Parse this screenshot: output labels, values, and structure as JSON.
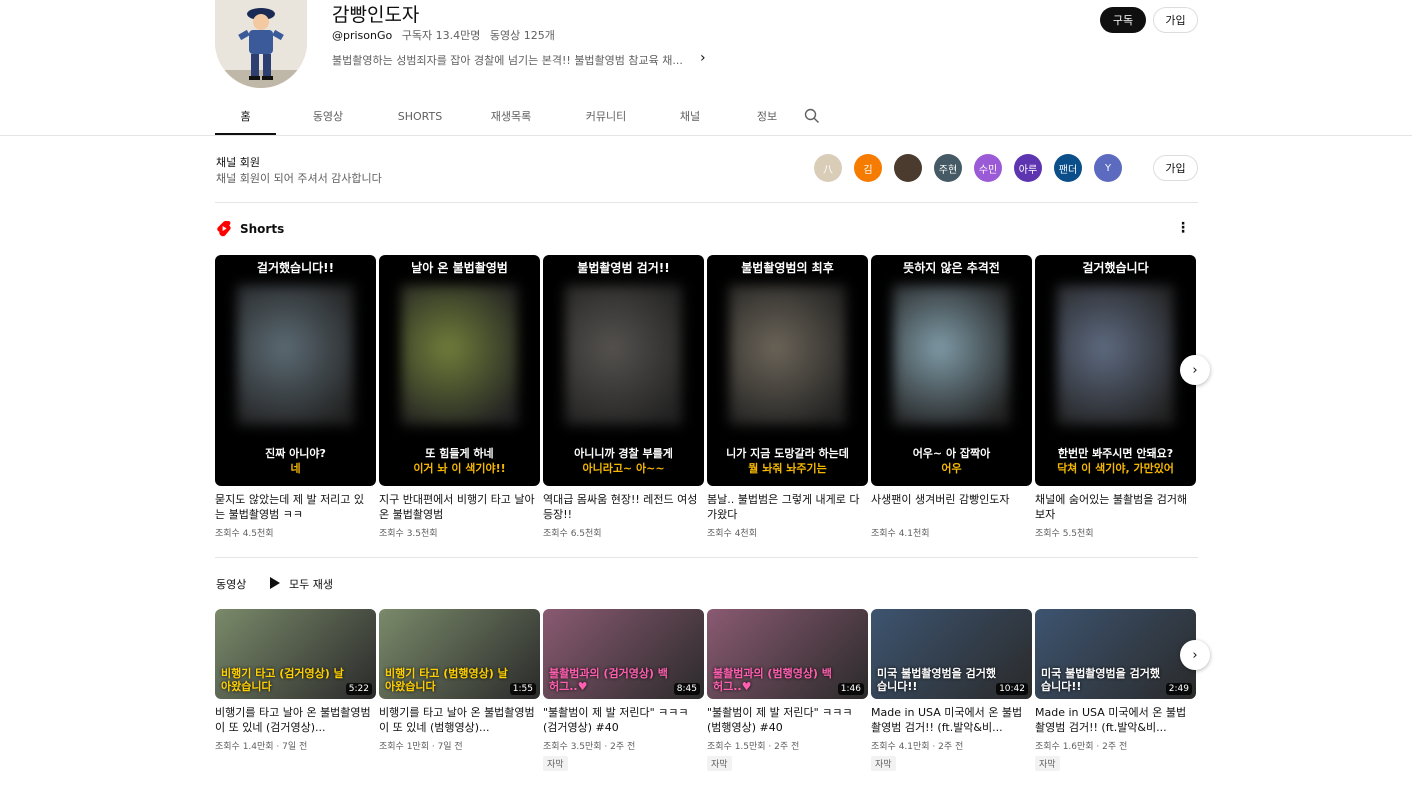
{
  "channel": {
    "name": "감빵인도자",
    "handle": "@prisonGo",
    "subscribers": "구독자 13.4만명",
    "video_count": "동영상 125개",
    "description": "불법촬영하는 성범죄자를 잡아 경찰에 넘기는 본격!! 불법촬영범 참교육 채...",
    "subscribe_label": "구독",
    "join_label": "가입"
  },
  "tabs": [
    "홈",
    "동영상",
    "SHORTS",
    "재생목록",
    "커뮤니티",
    "채널",
    "정보"
  ],
  "members": {
    "title": "채널 회원",
    "subtitle": "채널 회원이 되어 주셔서 감사합니다",
    "join_label": "가입",
    "avatars": [
      {
        "text": "八",
        "color": "#d9cdb8"
      },
      {
        "text": "김",
        "color": "#f57c00"
      },
      {
        "text": "",
        "color": "#4a3b2e"
      },
      {
        "text": "주현",
        "color": "#455a64"
      },
      {
        "text": "수민",
        "color": "#9c5bd6"
      },
      {
        "text": "아루",
        "color": "#5e35b1"
      },
      {
        "text": "팬더",
        "color": "#0b4f8a"
      },
      {
        "text": "Y",
        "color": "#5c6bc0"
      }
    ]
  },
  "shorts": {
    "title": "Shorts",
    "items": [
      {
        "top": "걸거했습니다!!",
        "cap1": "진짜 아니야?",
        "cap2": "네",
        "title": "묻지도 않았는데 제 발 저리고 있는 불법촬영범 ㅋㅋ",
        "views": "조회수 4.5천회",
        "blur": "#5b6a73"
      },
      {
        "top": "날아 온 불법촬영범",
        "cap1": "또 힘들게 하네",
        "cap2": "이거 놔 이 색기야!!",
        "title": "지구 반대편에서 비행기 타고 날아온 불법촬영범",
        "views": "조회수 3.5천회",
        "blur": "#6f7d3a"
      },
      {
        "top": "불법촬영범 검거!!",
        "cap1": "아니니까 경찰 부를게",
        "cap2": "아니라고~ 아~~",
        "title": "역대급 몸싸움 현장!! 레전드 여성 등장!!",
        "views": "조회수 6.5천회",
        "blur": "#55524f"
      },
      {
        "top": "불법촬영범의 최후",
        "cap1": "니가 지금 도망갈라 하는데",
        "cap2": "뭘 놔줘 놔주기는",
        "title": "봄날.. 불법범은 그렇게 내게로 다가왔다",
        "views": "조회수 4천회",
        "blur": "#6b6458"
      },
      {
        "top": "뜻하지 않은 추격전",
        "cap1": "어우~ 아 잡짝아",
        "cap2": "어우",
        "title": "사생팬이 생겨버린 감빵인도자",
        "views": "조회수 4.1천회",
        "blur": "#7e9aa6"
      },
      {
        "top": "걸거했습니다",
        "cap1": "한번만 봐주시면 안돼요?",
        "cap2": "닥쳐 이 색기야, 가만있어",
        "title": "채널에 숨어있는 불촬범을 검거해보자",
        "views": "조회수 5.5천회",
        "blur": "#5e6a80"
      }
    ]
  },
  "videos": {
    "title": "동영상",
    "play_all": "모두 재생",
    "items": [
      {
        "cap": "비행기 타고 (검거영상) 날아왔습니다",
        "duration": "5:22",
        "title": "비행기를 타고 날아 온 불법촬영범이 또 있네 (검거영상)...",
        "meta": "조회수 1.4만회 · 7일 전",
        "badge": "",
        "bg": "#7a8a6a",
        "capColor": "#ffd000"
      },
      {
        "cap": "비행기 타고 (범행영상) 날아왔습니다",
        "duration": "1:55",
        "title": "비행기를 타고 날아 온 불법촬영범이 또 있네 (범행영상)...",
        "meta": "조회수 1만회 · 7일 전",
        "badge": "",
        "bg": "#7a8a6a",
        "capColor": "#ffd000"
      },
      {
        "cap": "불촬범과의 (검거영상) 백허그..♥",
        "duration": "8:45",
        "title": "\"불촬범이 제 발 저린다\" ㅋㅋㅋ (검거영상) #40",
        "meta": "조회수 3.5만회 · 2주 전",
        "badge": "자막",
        "bg": "#8a5a72",
        "capColor": "#ff5fb0"
      },
      {
        "cap": "불촬범과의 (범행영상) 백허그..♥",
        "duration": "1:46",
        "title": "\"불촬범이 제 발 저린다\" ㅋㅋㅋ (범행영상) #40",
        "meta": "조회수 1.5만회 · 2주 전",
        "badge": "자막",
        "bg": "#8a5a72",
        "capColor": "#ff5fb0"
      },
      {
        "cap": "미국 불법촬영범을 검거했습니다!!",
        "duration": "10:42",
        "title": "Made in USA 미국에서 온 불법촬영범 검거!! (ft.발악&비...",
        "meta": "조회수 4.1만회 · 2주 전",
        "badge": "자막",
        "bg": "#3d5470",
        "capColor": "#ffffff"
      },
      {
        "cap": "미국 불법촬영범을 검거했습니다!!",
        "duration": "2:49",
        "title": "Made in USA 미국에서 온 불법촬영범 검거!! (ft.발악&비...",
        "meta": "조회수 1.6만회 · 2주 전",
        "badge": "자막",
        "bg": "#3d5470",
        "capColor": "#ffffff"
      }
    ]
  }
}
